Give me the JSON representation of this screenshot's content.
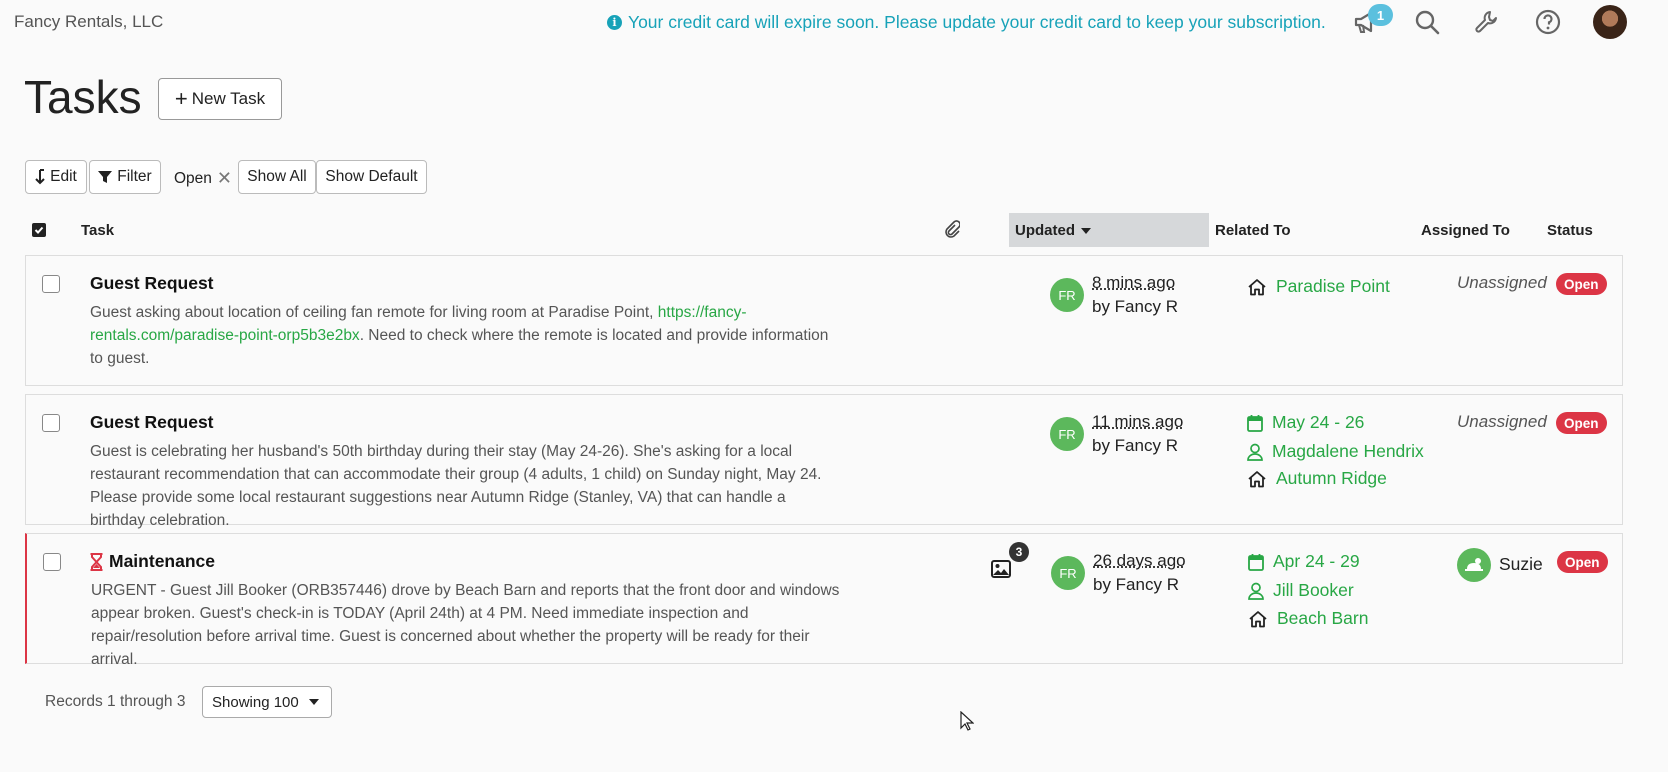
{
  "header": {
    "company": "Fancy Rentals, LLC",
    "notice": "Your credit card will expire soon. Please update your credit card to keep your subscription.",
    "announcement_count": "1",
    "icons": [
      "megaphone-icon",
      "search-icon",
      "wrench-icon",
      "help-icon"
    ]
  },
  "page": {
    "title": "Tasks",
    "new_task_label": "New Task"
  },
  "filters": {
    "edit_label": "Edit",
    "filter_label": "Filter",
    "active_filter": "Open",
    "show_all_label": "Show All",
    "show_default_label": "Show Default"
  },
  "table": {
    "columns": {
      "task": "Task",
      "updated": "Updated",
      "related_to": "Related To",
      "assigned_to": "Assigned To",
      "status": "Status"
    },
    "rows": [
      {
        "title": "Guest Request",
        "desc_before": "Guest asking about location of ceiling fan remote for living room at Paradise Point, ",
        "desc_link": "https://fancy-rentals.com/paradise-point-orp5b3e2bx",
        "desc_after": ". Need to check where the remote is located and provide information to guest.",
        "avatar": "FR",
        "updated": "8 mins ago",
        "updated_by": "by Fancy R",
        "property": "Paradise Point",
        "assigned": "Unassigned",
        "status": "Open"
      },
      {
        "title": "Guest Request",
        "desc": "Guest is celebrating her husband's 50th birthday during their stay (May 24-26). She's asking for a local restaurant recommendation that can accommodate their group (4 adults, 1 child) on Sunday night, May 24. Please provide some local restaurant suggestions near Autumn Ridge (Stanley, VA) that can handle a birthday celebration.",
        "avatar": "FR",
        "updated": "11 mins ago",
        "updated_by": "by Fancy R",
        "dates": "May 24 - 26",
        "guest": "Magdalene Hendrix",
        "property": "Autumn Ridge",
        "assigned": "Unassigned",
        "status": "Open"
      },
      {
        "title": "Maintenance",
        "desc": "URGENT - Guest Jill Booker (ORB357446) drove by Beach Barn and reports that the front door and windows appear broken. Guest's check-in is TODAY (April 24th) at 4 PM. Need immediate inspection and repair/resolution before arrival time. Guest is concerned about whether the property will be ready for their arrival.",
        "attachments": "3",
        "avatar": "FR",
        "updated": "26 days ago",
        "updated_by": "by Fancy R",
        "dates": "Apr 24 - 29",
        "guest": "Jill Booker",
        "property": "Beach Barn",
        "assigned": "Suzie",
        "status": "Open"
      }
    ]
  },
  "footer": {
    "records": "Records 1 through 3",
    "showing": "Showing 100"
  },
  "colors": {
    "accent": "#17a2b8",
    "link_green": "#28a745",
    "status_red": "#dc3545",
    "avatar_green": "#5cb85c"
  }
}
